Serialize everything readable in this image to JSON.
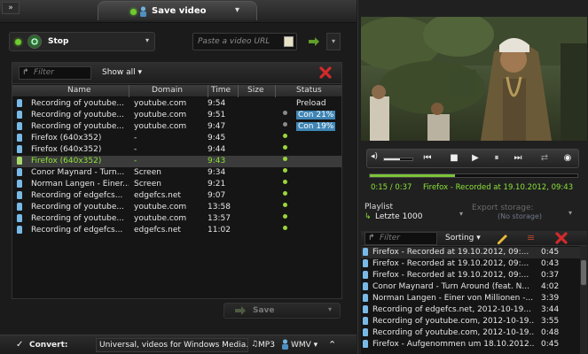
{
  "header": {
    "collapse_glyph": "»",
    "save_tab_label": "Save video",
    "tab_menu_glyph": "▾"
  },
  "capture": {
    "stop_label": "Stop",
    "url_placeholder": "Paste a video URL"
  },
  "list": {
    "filter_placeholder": "Filter",
    "show_all_label": "Show all ▾",
    "columns": [
      "Name",
      "Domain",
      "Time",
      "Size",
      "Status"
    ],
    "rows": [
      {
        "name": "Recording of  youtube...",
        "domain": "youtube.com",
        "time": "9:54",
        "size": "",
        "status": "Preload",
        "dot": ""
      },
      {
        "name": "Recording of  youtube...",
        "domain": "youtube.com",
        "time": "9:51",
        "size": "",
        "status": "Con 21%",
        "dot": "grey"
      },
      {
        "name": "Recording of  youtube...",
        "domain": "youtube.com",
        "time": "9:47",
        "size": "",
        "status": "Con 19%",
        "dot": "grey"
      },
      {
        "name": "Firefox (640x352)",
        "domain": "-",
        "time": "9:45",
        "size": "",
        "status": "",
        "dot": "green"
      },
      {
        "name": "Firefox (640x352)",
        "domain": "-",
        "time": "9:44",
        "size": "",
        "status": "",
        "dot": "green"
      },
      {
        "name": "Firefox (640x352)",
        "domain": "-",
        "time": "9:43",
        "size": "",
        "status": "",
        "dot": "green",
        "selected": true
      },
      {
        "name": "Conor Maynard - Turn...",
        "domain": "Screen",
        "time": "9:34",
        "size": "",
        "status": "",
        "dot": "green"
      },
      {
        "name": "Norman Langen - Einer...",
        "domain": "Screen",
        "time": "9:21",
        "size": "",
        "status": "",
        "dot": "green"
      },
      {
        "name": "Recording of  edgefcs...",
        "domain": "edgefcs.net",
        "time": "9:07",
        "size": "",
        "status": "",
        "dot": "green"
      },
      {
        "name": "Recording of  youtube...",
        "domain": "youtube.com",
        "time": "13:58",
        "size": "",
        "status": "",
        "dot": "green"
      },
      {
        "name": "Recording of  youtube...",
        "domain": "youtube.com",
        "time": "13:57",
        "size": "",
        "status": "",
        "dot": "green"
      },
      {
        "name": "Recording of  edgefcs...",
        "domain": "edgefcs.net",
        "time": "11:02",
        "size": "",
        "status": "",
        "dot": "green"
      }
    ]
  },
  "save": {
    "label": "Save"
  },
  "convert": {
    "checkbox_glyph": "✓",
    "label": "Convert:",
    "profile": "Universal, videos for Windows Media...",
    "audio_format": "MP3",
    "video_format": "WMV ▾",
    "expand_glyph": "⌃"
  },
  "player": {
    "position": "0:15 / 0:37",
    "title": "Firefox - Recorded at 19.10.2012, 09:43",
    "volume_level": 0.55,
    "progress": 0.41
  },
  "playlist": {
    "label": "Playlist",
    "selected": "Letzte 1000",
    "export_label": "Export storage:",
    "export_value": "(No storage)"
  },
  "playlist_toolbar": {
    "filter_placeholder": "Filter",
    "sorting_label": "Sorting ▾"
  },
  "playlist_items": [
    {
      "title": "Firefox - Recorded at 19.10.2012, 09:...",
      "duration": "0:45",
      "selected": true
    },
    {
      "title": "Firefox - Recorded at 19.10.2012, 09:...",
      "duration": "0:43"
    },
    {
      "title": "Firefox - Recorded at 19.10.2012, 09:...",
      "duration": "0:37"
    },
    {
      "title": "Conor Maynard - Turn Around (feat. N...",
      "duration": "4:02"
    },
    {
      "title": "Norman Langen - Einer von Millionen -...",
      "duration": "3:39"
    },
    {
      "title": "Recording of  edgefcs.net, 2012-10-19...",
      "duration": "3:44"
    },
    {
      "title": "Recording of  youtube.com, 2012-10-19...",
      "duration": "3:55"
    },
    {
      "title": "Recording of  youtube.com, 2012-10-19...",
      "duration": "0:48"
    },
    {
      "title": "Firefox - Aufgenommen um 18.10.2012...",
      "duration": "0:45"
    }
  ],
  "colors": {
    "accent_green": "#8be23a",
    "status_blue": "#3f86b5",
    "close_red": "#d32a2a"
  }
}
